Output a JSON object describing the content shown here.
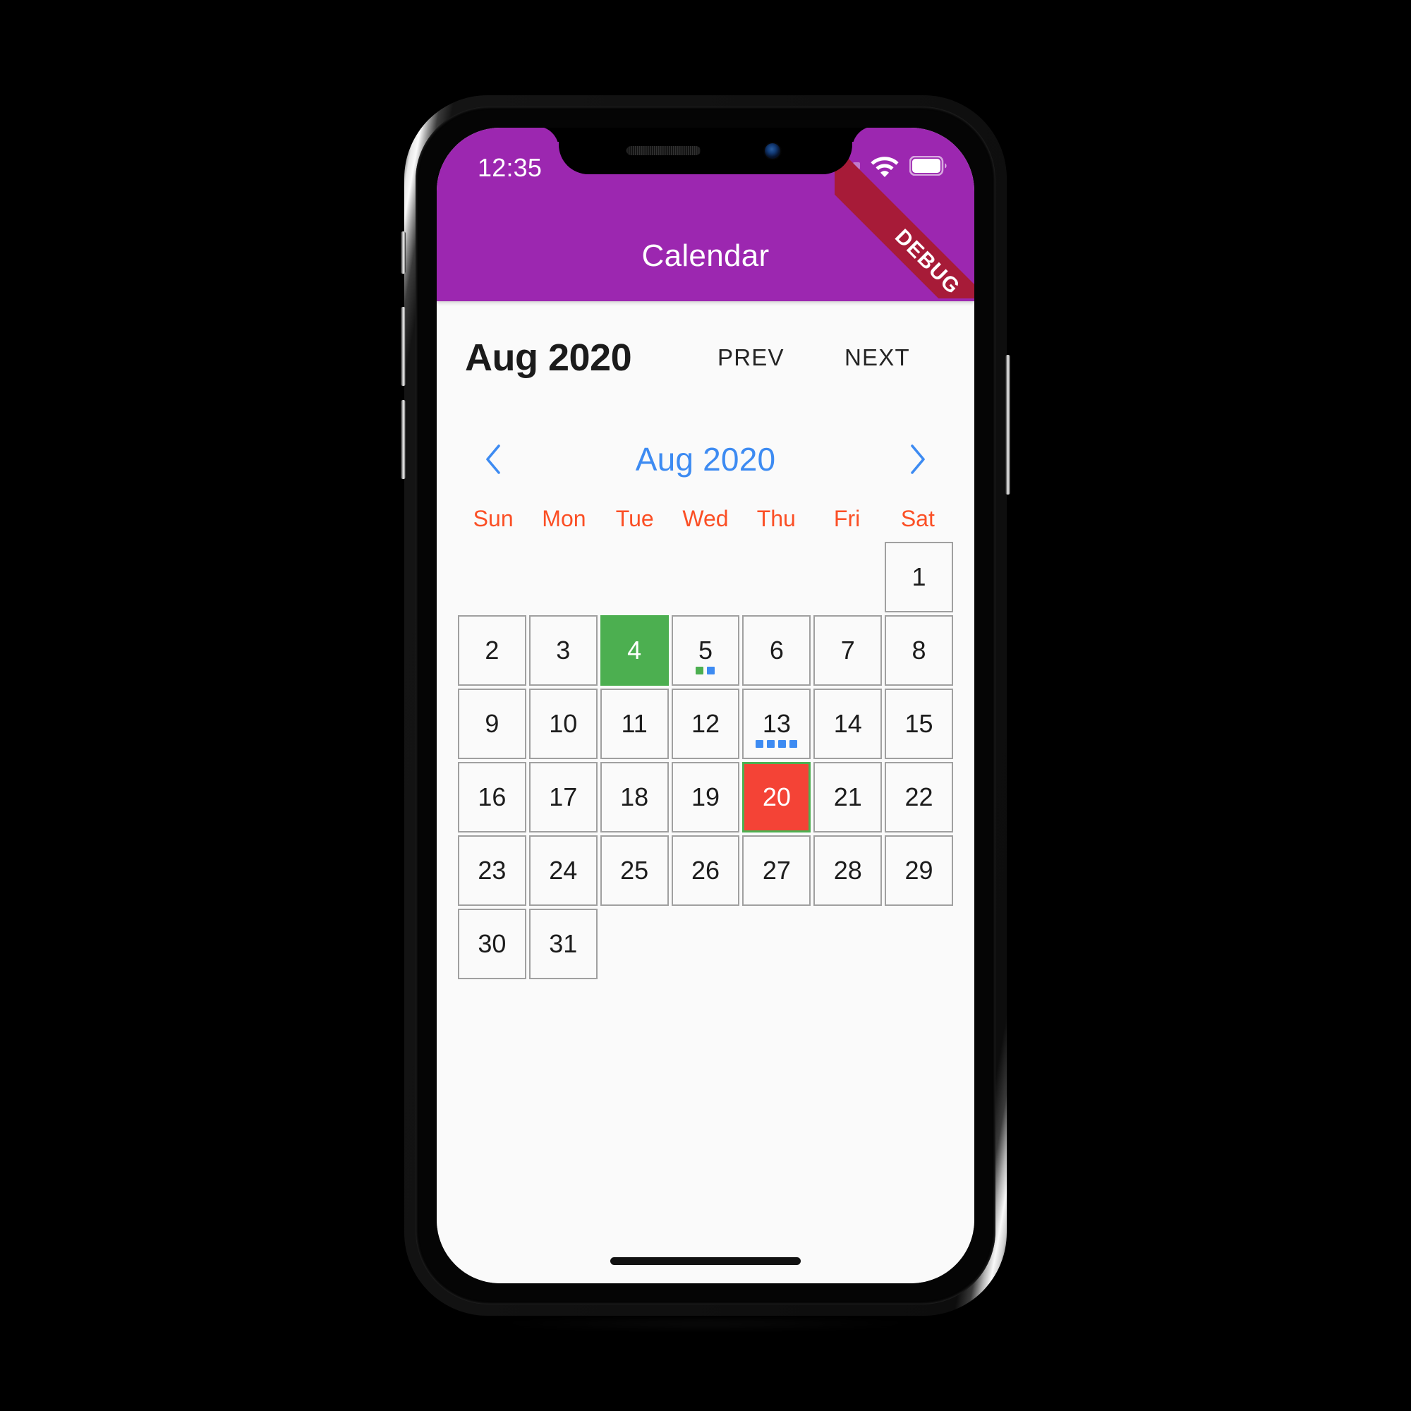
{
  "status_bar": {
    "time": "12:35",
    "wifi_icon": "wifi-icon",
    "battery_icon": "battery-icon",
    "signal_dots": 4,
    "debug_ribbon": "DEBUG",
    "debug_ribbon_color": "#A71B38",
    "background_color": "#9C27B0"
  },
  "app_bar": {
    "title": "Calendar",
    "background_color": "#9C27B0",
    "text_color": "#FFFFFF"
  },
  "month_toolbar": {
    "month_label": "Aug 2020",
    "prev_label": "PREV",
    "next_label": "NEXT"
  },
  "calendar": {
    "nav": {
      "prev_icon": "chevron-left-icon",
      "next_icon": "chevron-right-icon",
      "title": "Aug 2020",
      "title_color": "#3D8BF2"
    },
    "weekdays": [
      "Sun",
      "Mon",
      "Tue",
      "Wed",
      "Thu",
      "Fri",
      "Sat"
    ],
    "weekday_color": "#FB4F25",
    "leading_blanks": 6,
    "days": [
      {
        "n": "1",
        "state": "normal",
        "dots": []
      },
      {
        "n": "2",
        "state": "normal",
        "dots": []
      },
      {
        "n": "3",
        "state": "normal",
        "dots": []
      },
      {
        "n": "4",
        "state": "selected-green",
        "dots": []
      },
      {
        "n": "5",
        "state": "normal",
        "dots": [
          "#4CAF50",
          "#3D8BF2"
        ]
      },
      {
        "n": "6",
        "state": "normal",
        "dots": []
      },
      {
        "n": "7",
        "state": "normal",
        "dots": []
      },
      {
        "n": "8",
        "state": "normal",
        "dots": []
      },
      {
        "n": "9",
        "state": "normal",
        "dots": []
      },
      {
        "n": "10",
        "state": "normal",
        "dots": []
      },
      {
        "n": "11",
        "state": "normal",
        "dots": []
      },
      {
        "n": "12",
        "state": "normal",
        "dots": []
      },
      {
        "n": "13",
        "state": "normal",
        "dots": [
          "#3D8BF2",
          "#3D8BF2",
          "#3D8BF2",
          "#3D8BF2"
        ]
      },
      {
        "n": "14",
        "state": "normal",
        "dots": []
      },
      {
        "n": "15",
        "state": "normal",
        "dots": []
      },
      {
        "n": "16",
        "state": "normal",
        "dots": []
      },
      {
        "n": "17",
        "state": "normal",
        "dots": []
      },
      {
        "n": "18",
        "state": "normal",
        "dots": []
      },
      {
        "n": "19",
        "state": "normal",
        "dots": []
      },
      {
        "n": "20",
        "state": "today-red",
        "dots": []
      },
      {
        "n": "21",
        "state": "normal",
        "dots": []
      },
      {
        "n": "22",
        "state": "normal",
        "dots": []
      },
      {
        "n": "23",
        "state": "normal",
        "dots": []
      },
      {
        "n": "24",
        "state": "normal",
        "dots": []
      },
      {
        "n": "25",
        "state": "normal",
        "dots": []
      },
      {
        "n": "26",
        "state": "normal",
        "dots": []
      },
      {
        "n": "27",
        "state": "normal",
        "dots": []
      },
      {
        "n": "28",
        "state": "normal",
        "dots": []
      },
      {
        "n": "29",
        "state": "normal",
        "dots": []
      },
      {
        "n": "30",
        "state": "normal",
        "dots": []
      },
      {
        "n": "31",
        "state": "normal",
        "dots": []
      }
    ],
    "colors": {
      "selected_green": "#4CAF50",
      "today_red": "#F44336",
      "today_border": "#4CAF50",
      "cell_border": "#A0A0A0",
      "page_background": "#FAFAFA"
    }
  },
  "device": {
    "home_indicator": "home-indicator",
    "buttons": [
      "mute-switch",
      "volume-up-button",
      "volume-down-button",
      "power-button"
    ]
  }
}
